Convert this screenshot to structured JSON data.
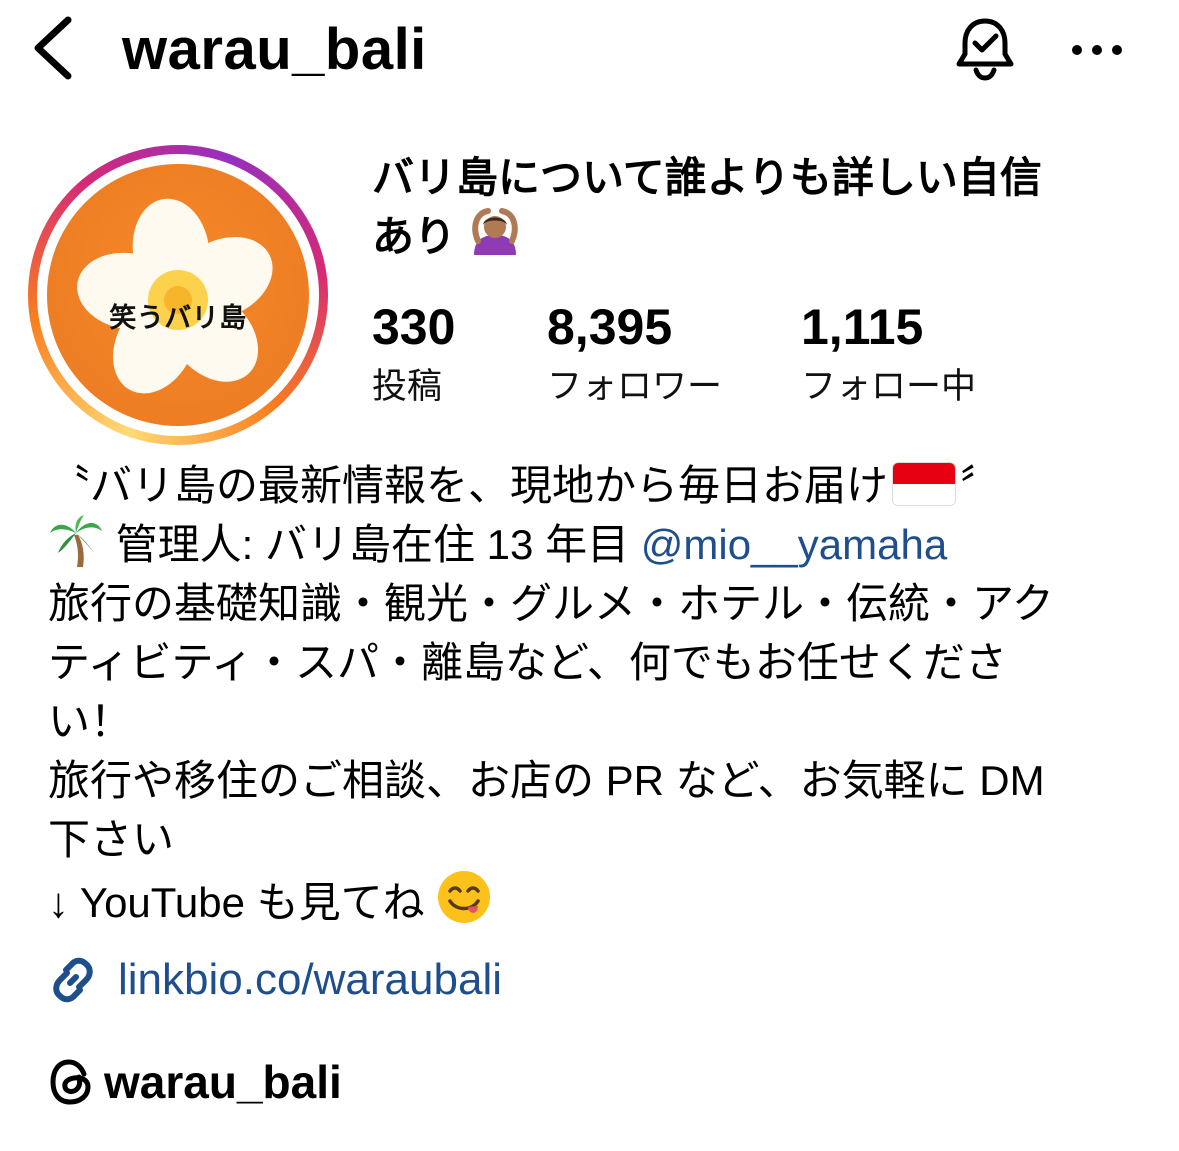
{
  "header": {
    "username": "warau_bali",
    "icons": {
      "back": "chevron-left-icon",
      "notify": "bell-check-icon",
      "more": "more-horizontal-icon"
    }
  },
  "avatar": {
    "text": "笑うバリ島"
  },
  "profile": {
    "name_line1": "バリ島について誰よりも詳しい自信",
    "name_line2": "あり",
    "name_emoji": "woman-gesturing-ok-emoji"
  },
  "stats": {
    "posts": {
      "value": "330",
      "label": "投稿"
    },
    "followers": {
      "value": "8,395",
      "label": "フォロワー"
    },
    "following": {
      "value": "1,115",
      "label": "フォロー中"
    }
  },
  "bio": {
    "line1": "〝バリ島の最新情報を、現地から毎日お届け",
    "line1_end": "〞",
    "line2_prefix": "管理人: バリ島在住 13 年目",
    "mention": "@mio__yamaha",
    "line3": "旅行の基礎知識・観光・グルメ・ホテル・伝統・アク",
    "line4": "ティビティ・スパ・離島など、何でもお任せくださ",
    "line5": "い！",
    "line6": "旅行や移住のご相談、お店の PR など、お気軽に DM",
    "line7": "下さい",
    "line8": "↓ YouTube も見てね"
  },
  "link": {
    "text": "linkbio.co/waraubali"
  },
  "threads": {
    "handle": "warau_bali"
  },
  "colors": {
    "link_blue": "#1f4e8c",
    "avatar_orange": "#ef7f24"
  }
}
